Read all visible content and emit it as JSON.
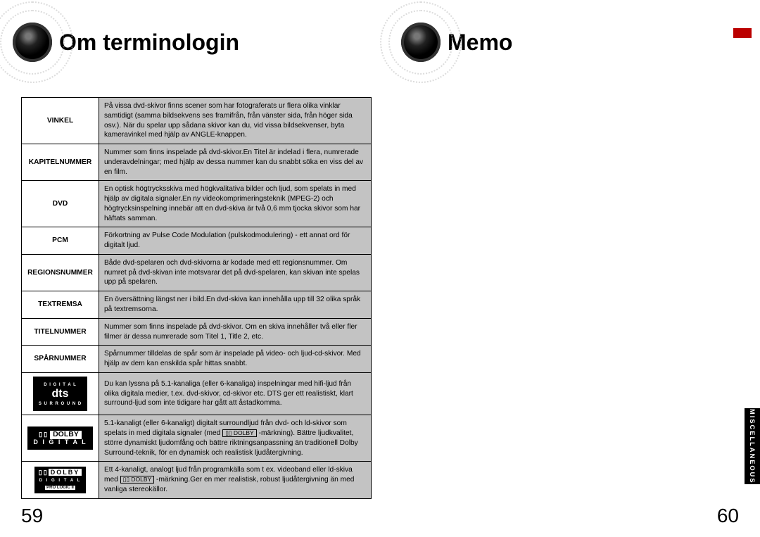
{
  "left": {
    "title": "Om terminologin",
    "pageNumber": "59",
    "rows": [
      {
        "term": "VINKEL",
        "desc": "På vissa dvd-skivor finns scener som har fotograferats ur flera olika vinklar samtidigt (samma bildsekvens ses framifrån, från vänster sida, från höger sida osv.).\nNär du spelar upp sådana skivor kan du, vid vissa bildsekvenser, byta kameravinkel med hjälp av ANGLE-knappen."
      },
      {
        "term": "KAPITELNUMMER",
        "desc": "Nummer som finns inspelade på dvd-skivor.En Titel är indelad i flera, numrerade underavdelningar; med hjälp av dessa nummer kan du snabbt söka en viss del av en film."
      },
      {
        "term": "DVD",
        "desc": "En optisk högtrycksskiva med högkvalitativa bilder och ljud, som spelats in med hjälp av digitala signaler.En ny videokomprimeringsteknik (MPEG-2) och högtrycksinspelning innebär att en dvd-skiva är två 0,6 mm tjocka skivor som har häftats samman."
      },
      {
        "term": "PCM",
        "desc": "Förkortning av Pulse Code Modulation (pulskodmodulering) - ett annat ord för digitalt ljud."
      },
      {
        "term": "REGIONSNUMMER",
        "desc": "Både dvd-spelaren och dvd-skivorna är kodade med ett regionsnummer.\nOm numret på dvd-skivan inte motsvarar det på dvd-spelaren, kan skivan inte spelas upp på spelaren."
      },
      {
        "term": "TEXTREMSA",
        "desc": "En översättning längst ner i bild.En dvd-skiva kan innehålla upp till 32 olika språk på textremsorna."
      },
      {
        "term": "TITELNUMMER",
        "desc": "Nummer som finns inspelade på dvd-skivor. Om en skiva innehåller två eller fler filmer är dessa numrerade som Titel 1, Title 2, etc."
      },
      {
        "term": "SPÅRNUMMER",
        "desc": "Spårnummer tilldelas de spår som är inspelade på video- och ljud-cd-skivor. Med hjälp av dem kan enskilda spår hittas snabbt."
      },
      {
        "logo": "dts",
        "desc": "Du kan lyssna på 5.1-kanaliga (eller 6-kanaliga) inspelningar med hifi-ljud från olika digitala medier, t.ex. dvd-skivor, cd-skivor etc.\nDTS ger ett realistiskt, klart surround-ljud som inte tidigare har gått att åstadkomma."
      },
      {
        "logo": "dolby-digital",
        "descPre": "5.1-kanaligt (eller 6-kanaligt) digitalt surroundljud från dvd- och ld-skivor som spelats in med digitala signaler (med ",
        "descPost": " -märkning). Bättre ljudkvalitet, större dynamiskt ljudomfång och bättre riktningsanpassning än traditionell Dolby Surround-teknik, för en dynamisk och realistisk ljudåtergivning."
      },
      {
        "logo": "dolby-prologic",
        "descPre": "Ett 4-kanaligt, analogt ljud från programkälla som t ex. videoband eller ld-skiva med ",
        "descPost": " -märkning.Ger en mer realistisk, robust ljudåtergivning än med vanliga stereokällor."
      }
    ],
    "logos": {
      "dts": {
        "top": "D I G I T A L",
        "mid": "dts",
        "bot": "S U R R O U N D"
      },
      "dolbyDigital": {
        "dd": "▯▯",
        "name": "DOLBY",
        "sub": "D I G I T A L"
      },
      "dolbyPrologic": {
        "dd": "▯▯",
        "name": "DOLBY",
        "sub": "D I G I T A L",
        "pl": "PRO LOGIC II"
      },
      "inlineBadge": "▯▯ DOLBY"
    }
  },
  "right": {
    "title": "Memo",
    "pageNumber": "60",
    "sideTab": "MISCELLANEOUS"
  }
}
